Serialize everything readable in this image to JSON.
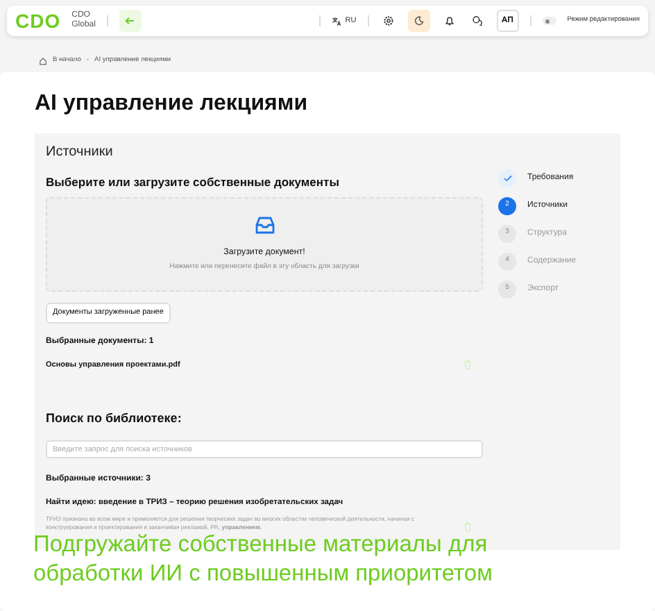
{
  "header": {
    "logo": "CDO",
    "brand": [
      "CDO",
      "Global"
    ],
    "language": "RU",
    "theme_highlighted": true,
    "avatar": "АП",
    "edit_mode": {
      "label": "Режим редактирования",
      "on": false
    }
  },
  "breadcrumb": [
    "В начало",
    "AI управление лекциями"
  ],
  "breadcrumb_separator": "-",
  "title": "AI управление лекциями",
  "section_title": "Источники",
  "upload": {
    "heading": "Выберите или загрузите собственные документы",
    "title": "Загрузите документ!",
    "hint": "Нажмите или перенесите файл в эту область для загрузки",
    "button": "Документы загруженные ранее"
  },
  "selected_documents": {
    "label": "Выбранные документы: 1",
    "items": [
      "Основы управления проектами.pdf"
    ]
  },
  "library": {
    "heading": "Поиск по библиотеке:",
    "placeholder": "Введите запрос для поиска источников",
    "selected_label": "Выбранные источники: 3",
    "items": [
      {
        "title": "Найти идею: введение в ТРИЗ – теорию решения изобретательских задач",
        "description": "ТРИЗ признана во всем мире и применяется для решения творческих задач во многих областях человеческой деятельности, начиная с конструирования и проектирования и заканчивая рекламой, PR, **управлением**."
      }
    ]
  },
  "steps": [
    {
      "label": "Требования",
      "done": true,
      "selected": false
    },
    {
      "number": "2",
      "label": "Источники",
      "done": false,
      "selected": true
    },
    {
      "number": "3",
      "label": "Структура",
      "done": false,
      "selected": false
    },
    {
      "number": "4",
      "label": "Содержание",
      "done": false,
      "selected": false
    },
    {
      "number": "5",
      "label": "Экспорт",
      "done": false,
      "selected": false
    }
  ],
  "caption": "Подгружайте собственные материалы для обработки ИИ с повышенным приоритетом"
}
